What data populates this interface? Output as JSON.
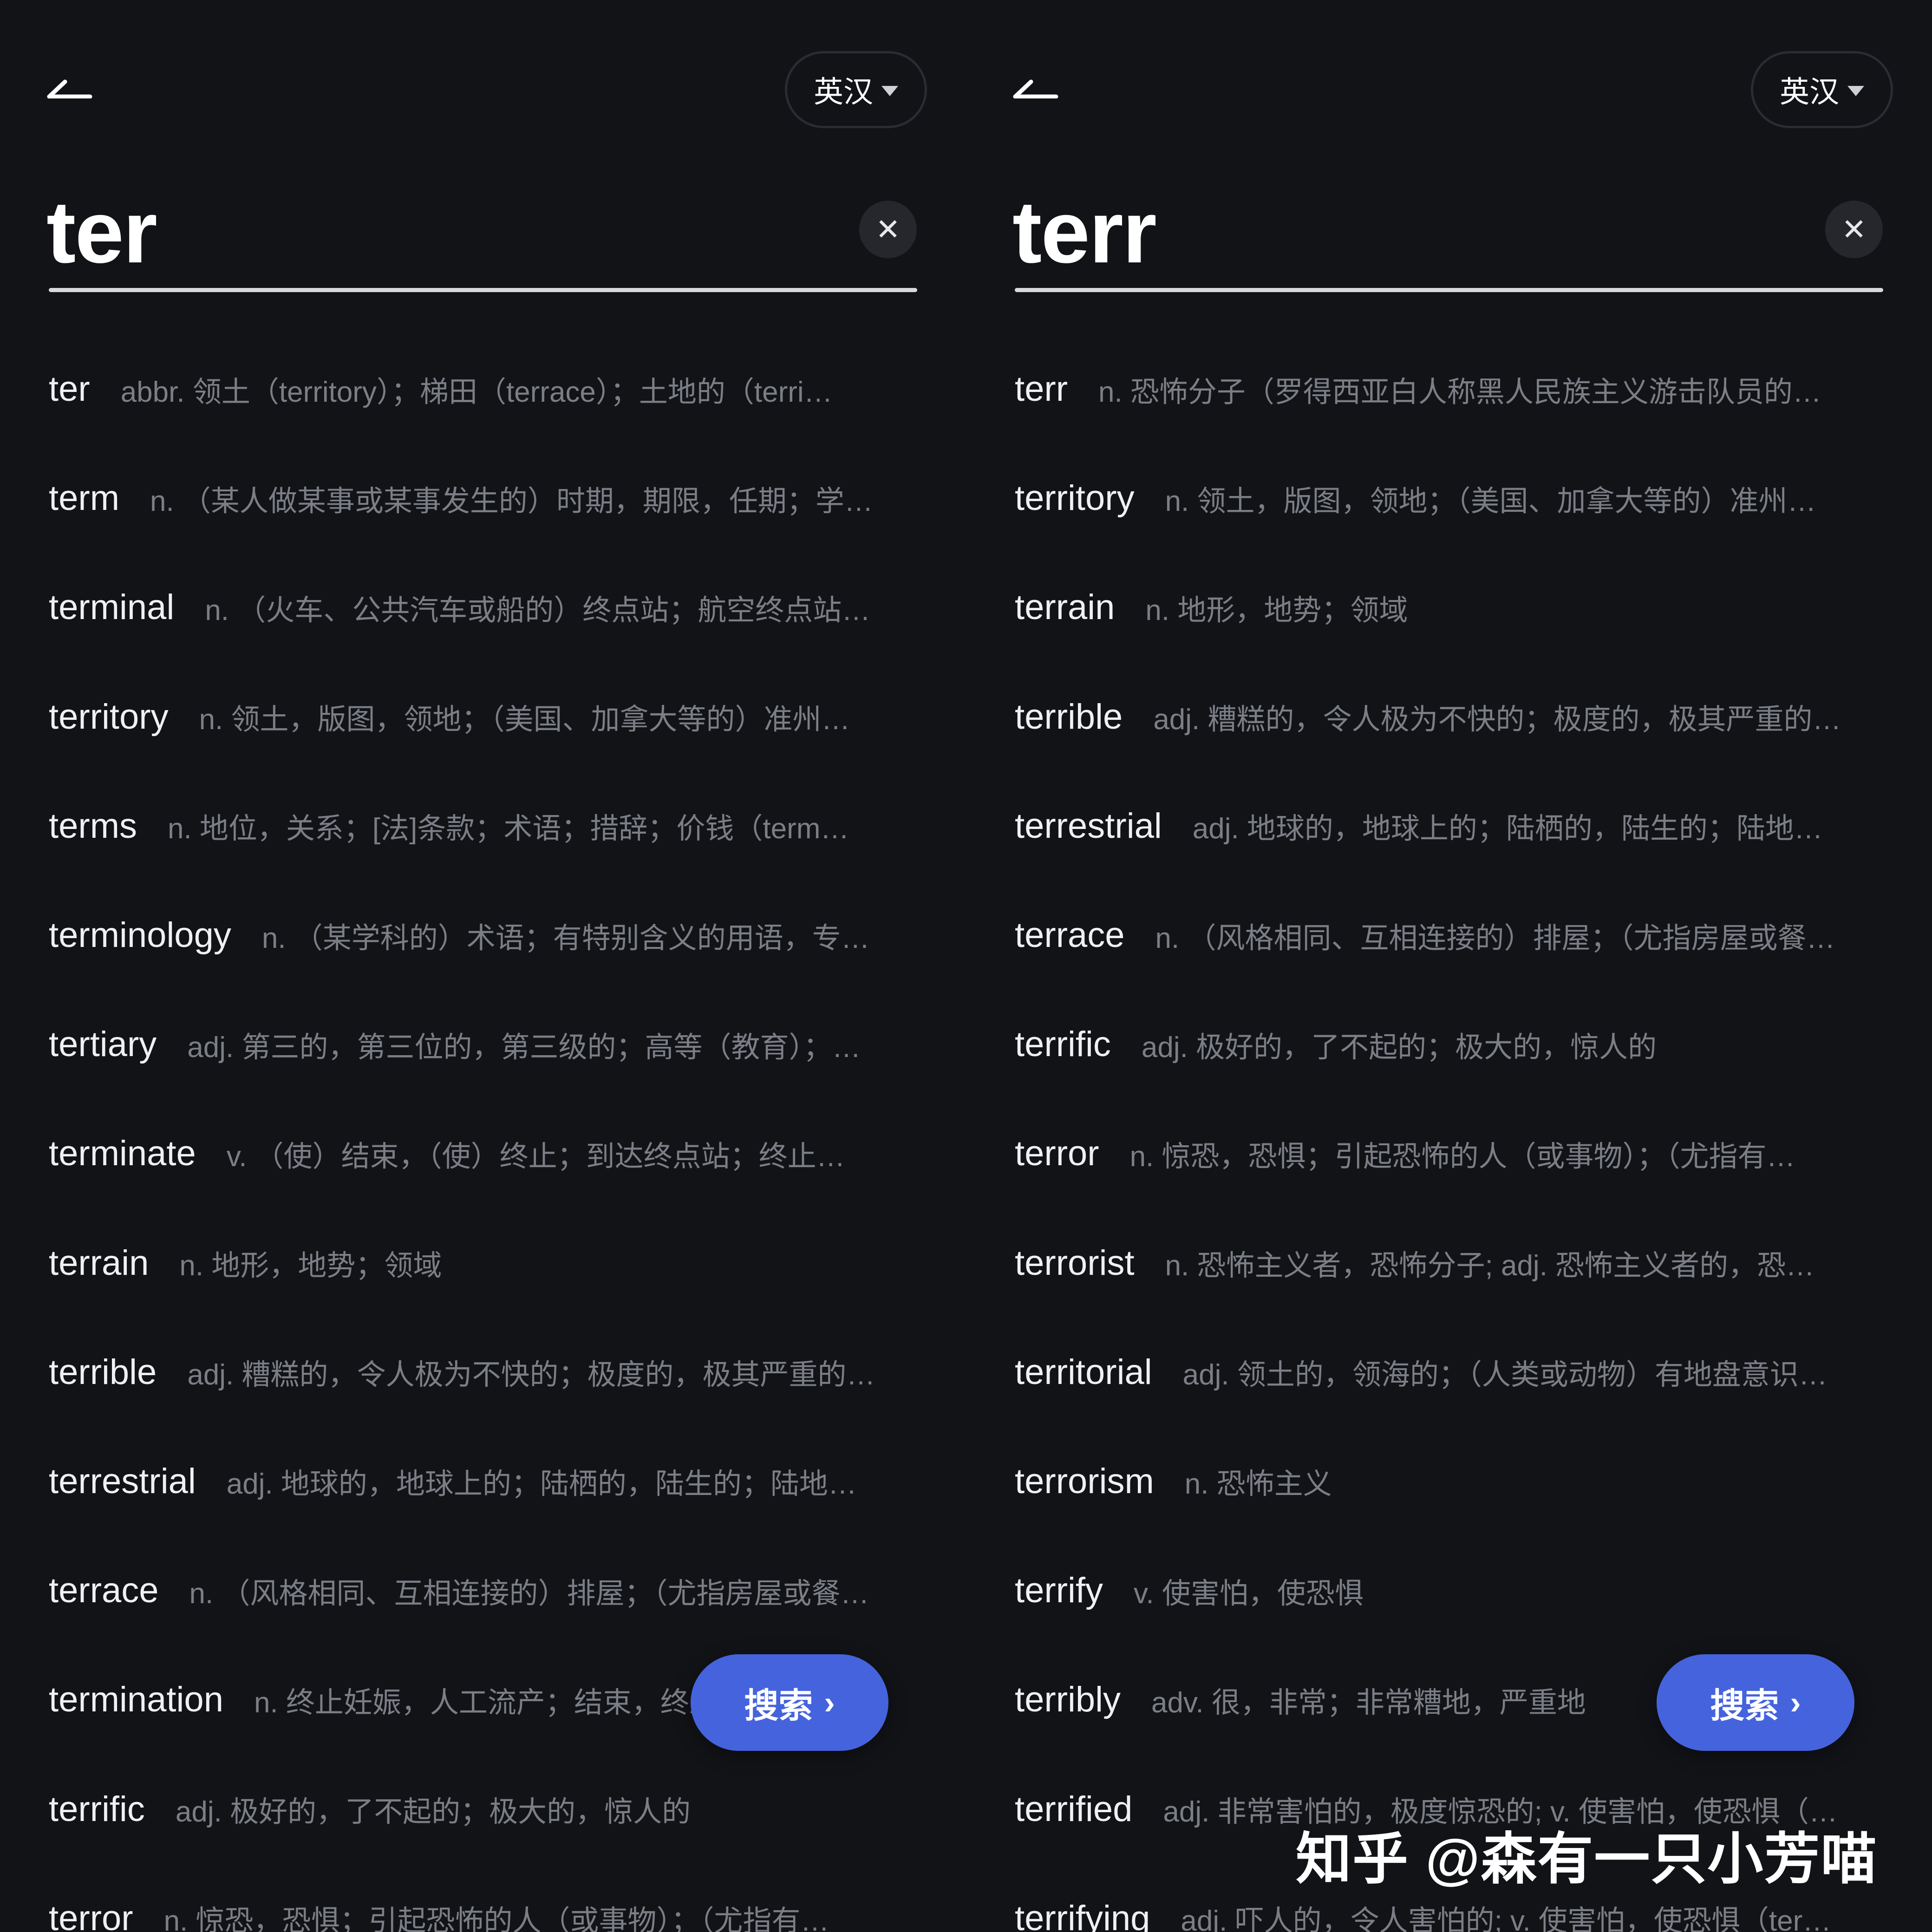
{
  "left": {
    "lang_label": "英汉",
    "query": "ter",
    "clear_label": "✕",
    "search_label": "搜索",
    "search_chevron": "›",
    "results": [
      {
        "word": "ter",
        "def": "abbr. 领土（territory）；梯田（terrace）；土地的（terri…"
      },
      {
        "word": "term",
        "def": "n. （某人做某事或某事发生的）时期，期限，任期；学…"
      },
      {
        "word": "terminal",
        "def": "n. （火车、公共汽车或船的）终点站；航空终点站…"
      },
      {
        "word": "territory",
        "def": "n. 领土，版图，领地；（美国、加拿大等的）准州…"
      },
      {
        "word": "terms",
        "def": "n. 地位，关系；[法]条款；术语；措辞；价钱（term…"
      },
      {
        "word": "terminology",
        "def": "n. （某学科的）术语；有特别含义的用语，专…"
      },
      {
        "word": "tertiary",
        "def": "adj. 第三的，第三位的，第三级的；高等（教育）；…"
      },
      {
        "word": "terminate",
        "def": "v. （使）结束，（使）终止；到达终点站；终止…"
      },
      {
        "word": "terrain",
        "def": "n. 地形，地势；领域"
      },
      {
        "word": "terrible",
        "def": "adj. 糟糕的，令人极为不快的；极度的，极其严重的…"
      },
      {
        "word": "terrestrial",
        "def": "adj. 地球的，地球上的；陆栖的，陆生的；陆地…"
      },
      {
        "word": "terrace",
        "def": "n. （风格相同、互相连接的）排屋；（尤指房屋或餐…"
      },
      {
        "word": "termination",
        "def": "n. 终止妊娠，人工流产；结束，终止；解…"
      },
      {
        "word": "terrific",
        "def": "adj. 极好的，了不起的；极大的，惊人的"
      },
      {
        "word": "terror",
        "def": "n. 惊恐，恐惧；引起恐怖的人（或事物）；（尤指有…"
      }
    ]
  },
  "right": {
    "lang_label": "英汉",
    "query": "terr",
    "clear_label": "✕",
    "search_label": "搜索",
    "search_chevron": "›",
    "results": [
      {
        "word": "terr",
        "def": "n. 恐怖分子（罗得西亚白人称黑人民族主义游击队员的…"
      },
      {
        "word": "territory",
        "def": "n. 领土，版图，领地；（美国、加拿大等的）准州…"
      },
      {
        "word": "terrain",
        "def": "n. 地形，地势；领域"
      },
      {
        "word": "terrible",
        "def": "adj. 糟糕的，令人极为不快的；极度的，极其严重的…"
      },
      {
        "word": "terrestrial",
        "def": "adj. 地球的，地球上的；陆栖的，陆生的；陆地…"
      },
      {
        "word": "terrace",
        "def": "n. （风格相同、互相连接的）排屋；（尤指房屋或餐…"
      },
      {
        "word": "terrific",
        "def": "adj. 极好的，了不起的；极大的，惊人的"
      },
      {
        "word": "terror",
        "def": "n. 惊恐，恐惧；引起恐怖的人（或事物）；（尤指有…"
      },
      {
        "word": "terrorist",
        "def": "n. 恐怖主义者，恐怖分子; adj. 恐怖主义者的，恐…"
      },
      {
        "word": "territorial",
        "def": "adj. 领土的，领海的；（人类或动物）有地盘意识…"
      },
      {
        "word": "terrorism",
        "def": "n. 恐怖主义"
      },
      {
        "word": "terrify",
        "def": "v. 使害怕，使恐惧"
      },
      {
        "word": "terribly",
        "def": "adv. 很，非常；非常糟地，严重地"
      },
      {
        "word": "terrified",
        "def": "adj. 非常害怕的，极度惊恐的; v. 使害怕，使恐惧（…"
      },
      {
        "word": "terrifying",
        "def": "adj. 吓人的，令人害怕的; v. 使害怕，使恐惧（ter…"
      }
    ]
  },
  "watermark": "知乎 @森有一只小芳喵",
  "colors": {
    "background": "#121317",
    "accent": "#4563dd",
    "definition_text": "#7c7e86"
  },
  "icons": [
    "back-arrow-icon",
    "caret-down-icon",
    "clear-icon",
    "chevron-right-icon"
  ]
}
